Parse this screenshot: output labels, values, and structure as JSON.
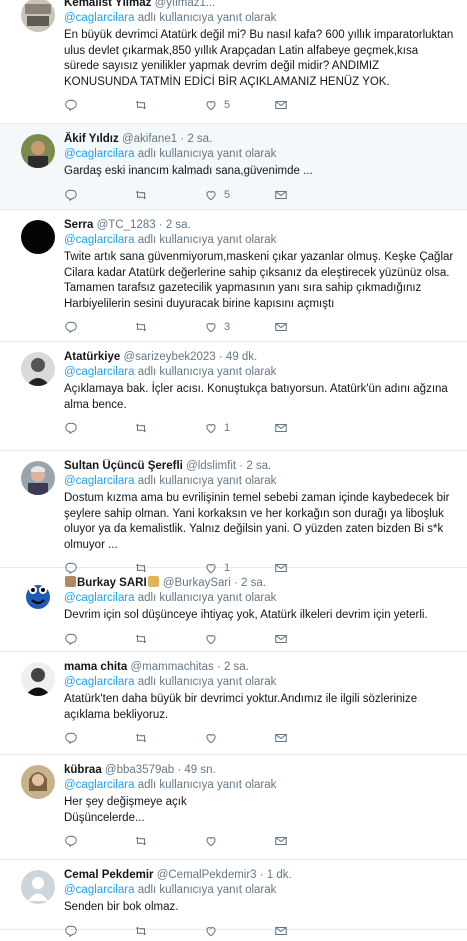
{
  "reply_prefix": "adlı kullanıcıya yanıt olarak",
  "tweets": [
    {
      "name": "Kemalist Yılmaz",
      "handle": "@yılmaz1...",
      "time": "",
      "replying_to": "@caglarcilara",
      "lines": [
        "En büyük devrimci Atatürk değil mi? Bu nasıl kafa? 600 yıllık imparatorluktan ulus devlet çıkarmak,850 yıllık Arapçadan Latin alfabeye geçmek,kısa sürede sayısız yenilikler yapmak devrim değil midir? ANDIMIZ KONUSUNDA TATMİN EDİCİ BİR AÇIKLAMANIZ HENÜZ YOK."
      ],
      "replies": "",
      "retweets": "",
      "likes": "5"
    },
    {
      "name": "Âkif Yıldız",
      "handle": "@akifane1",
      "time": "2 sa.",
      "replying_to": "@caglarcilara",
      "lines": [
        "Gardaş eski inancım kalmadı sana,güvenimde ..."
      ],
      "replies": "",
      "retweets": "",
      "likes": "5"
    },
    {
      "name": "Serra",
      "handle": "@TC_1283",
      "time": "2 sa.",
      "replying_to": "@caglarcilara",
      "lines": [
        "Twite artık sana güvenmiyorum,maskeni çıkar yazanlar olmuş. Keşke Çağlar Cilara kadar Atatürk değerlerine sahip çıksanız da eleştirecek yüzünüz olsa. Tamamen tarafsız gazetecilik yapmasının yanı sıra sahip çıkmadığınız Harbiyelilerin sesini duyuracak birine kapısını açmıştı"
      ],
      "replies": "",
      "retweets": "",
      "likes": "3"
    },
    {
      "name": "Atatürkiye",
      "handle": "@sarizeybek2023",
      "time": "49 dk.",
      "replying_to": "@caglarcilara",
      "lines": [
        "Açıklamaya bak. İçler acısı. Konuştukça batıyorsun. Atatürk'ün adını ağzına alma bence."
      ],
      "replies": "",
      "retweets": "",
      "likes": "1"
    },
    {
      "name": "Sultan Üçüncü Şerefli",
      "handle": "@ldslimfit",
      "time": "2 sa.",
      "replying_to": "@caglarcilara",
      "lines": [
        "Dostum kızma ama bu evrilişinin temel sebebi zaman içinde kaybedecek bir şeylere sahip olman. Yani korkaksın ve her korkağın son durağı ya liboşluk oluyor ya da kemalistlik. Yalnız değilsin yani. O yüzden zaten bizden Bi s*k olmuyor ..."
      ],
      "replies": "",
      "retweets": "",
      "likes": "1"
    },
    {
      "name": "Burkay SARI",
      "handle": "@BurkaySari",
      "time": "2 sa.",
      "replying_to": "@caglarcilara",
      "lines": [
        "Devrim için sol düşünceye ihtiyaç yok, Atatürk ilkeleri devrim için yeterli."
      ],
      "replies": "",
      "retweets": "",
      "likes": ""
    },
    {
      "name": "mama chita",
      "handle": "@mammachitas",
      "time": "2 sa.",
      "replying_to": "@caglarcilara",
      "lines": [
        "Atatürk'ten daha büyük bir devrimci yoktur.Andımız ile ilgili sözlerinize açıklama bekliyoruz."
      ],
      "replies": "",
      "retweets": "",
      "likes": ""
    },
    {
      "name": "kübraa",
      "handle": "@bba3579ab",
      "time": "49 sn.",
      "replying_to": "@caglarcilara",
      "lines": [
        "Her şey değişmeye açık",
        "Düşüncelerde..."
      ],
      "replies": "",
      "retweets": "",
      "likes": ""
    },
    {
      "name": "Cemal Pekdemir",
      "handle": "@CemalPekdemir3",
      "time": "1 dk.",
      "replying_to": "@caglarcilara",
      "lines": [
        "Senden bir bok olmaz."
      ],
      "replies": "",
      "retweets": "",
      "likes": ""
    }
  ],
  "icons": {
    "reply": "reply-icon",
    "retweet": "retweet-icon",
    "like": "heart-icon",
    "dm": "envelope-icon"
  },
  "colors": {
    "link": "#1da1f2",
    "muted": "#657786",
    "highlight_bg": "#f5f8fa",
    "divider": "#e6ecf0"
  }
}
